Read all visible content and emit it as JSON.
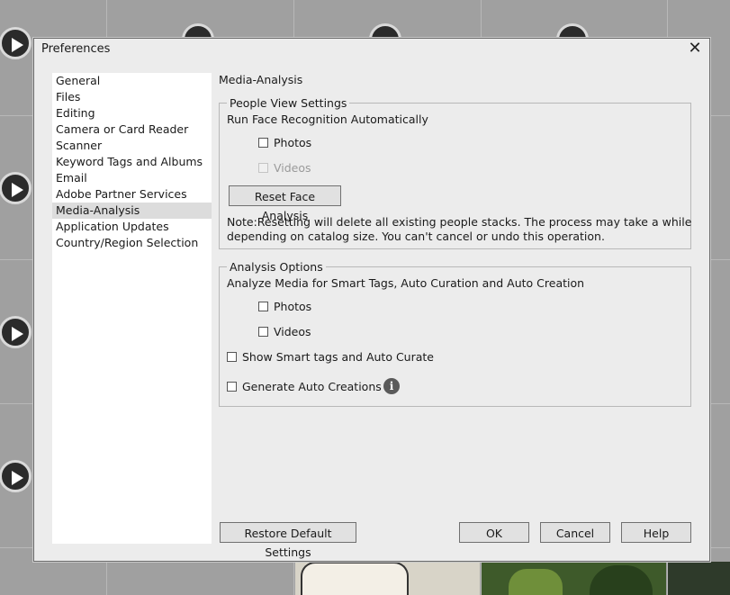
{
  "dialog": {
    "title": "Preferences",
    "close_glyph": "✕"
  },
  "nav": {
    "items": [
      {
        "label": "General"
      },
      {
        "label": "Files"
      },
      {
        "label": "Editing"
      },
      {
        "label": "Camera or Card Reader"
      },
      {
        "label": "Scanner"
      },
      {
        "label": "Keyword Tags and Albums"
      },
      {
        "label": "Email"
      },
      {
        "label": "Adobe Partner Services"
      },
      {
        "label": "Media-Analysis",
        "selected": true
      },
      {
        "label": "Application Updates"
      },
      {
        "label": "Country/Region Selection"
      }
    ]
  },
  "content": {
    "section_title": "Media-Analysis",
    "people": {
      "legend": "People View Settings",
      "run_label": "Run Face Recognition Automatically",
      "photos_label": "Photos",
      "photos_checked": false,
      "videos_label": "Videos",
      "videos_checked": false,
      "videos_disabled": true,
      "reset_button": "Reset Face Analysis",
      "note_line1": "Note:Resetting will delete all existing people stacks. The process may take a while",
      "note_line2": "depending on catalog size. You can't cancel or undo this operation."
    },
    "analysis": {
      "legend": "Analysis Options",
      "analyze_label": "Analyze Media for Smart Tags, Auto Curation and Auto Creation",
      "photos_label": "Photos",
      "photos_checked": false,
      "videos_label": "Videos",
      "videos_checked": false,
      "smart_tags_label": "Show Smart tags and Auto Curate",
      "smart_tags_checked": false,
      "auto_creations_label": "Generate Auto Creations",
      "auto_creations_checked": false,
      "info_glyph": "i"
    }
  },
  "footer": {
    "restore_button": "Restore Default Settings",
    "ok_button": "OK",
    "cancel_button": "Cancel",
    "help_button": "Help"
  },
  "icons": {
    "play": "play-icon",
    "info": "info-icon",
    "close": "close-icon"
  }
}
